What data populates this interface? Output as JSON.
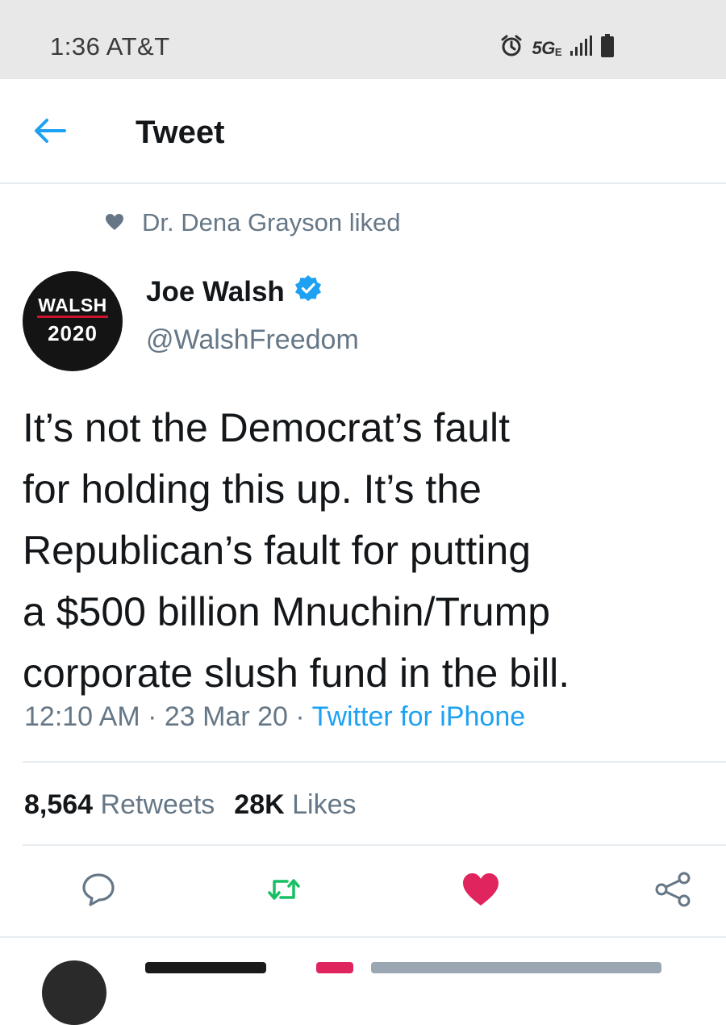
{
  "status_bar": {
    "time": "1:36",
    "carrier": "AT&T",
    "network": "5G",
    "network_suffix": "E",
    "icons": [
      "alarm-icon",
      "signal-icon",
      "battery-icon"
    ]
  },
  "nav": {
    "title": "Tweet",
    "back_icon": "arrow-left-icon"
  },
  "social_context": {
    "text": "Dr. Dena Grayson liked",
    "icon": "heart-icon"
  },
  "tweet": {
    "avatar": {
      "line1": "WALSH",
      "line2": "2020"
    },
    "author_name": "Joe Walsh",
    "verified_icon": "verified-badge-icon",
    "handle": "@WalshFreedom",
    "text_lines": [
      "It’s not the Democrat’s fault",
      "for holding this up. It’s the",
      "Republican’s fault for putting",
      "a $500 billion Mnuchin/Trump",
      "corporate slush fund in the bill."
    ],
    "time": "12:10 AM",
    "separator": " · ",
    "date": "23 Mar 20",
    "source": "Twitter for iPhone"
  },
  "stats": {
    "retweets_count": "8,564",
    "retweets_label": "Retweets",
    "likes_count": "28K",
    "likes_label": "Likes"
  },
  "actions": [
    "reply-icon",
    "retweet-icon",
    "like-icon",
    "share-icon"
  ],
  "colors": {
    "accent": "#1da1f2",
    "retweet": "#17bf63",
    "like": "#e0245e",
    "secondary_text": "#657786",
    "status_bar_bg": "#e8e8e8"
  }
}
